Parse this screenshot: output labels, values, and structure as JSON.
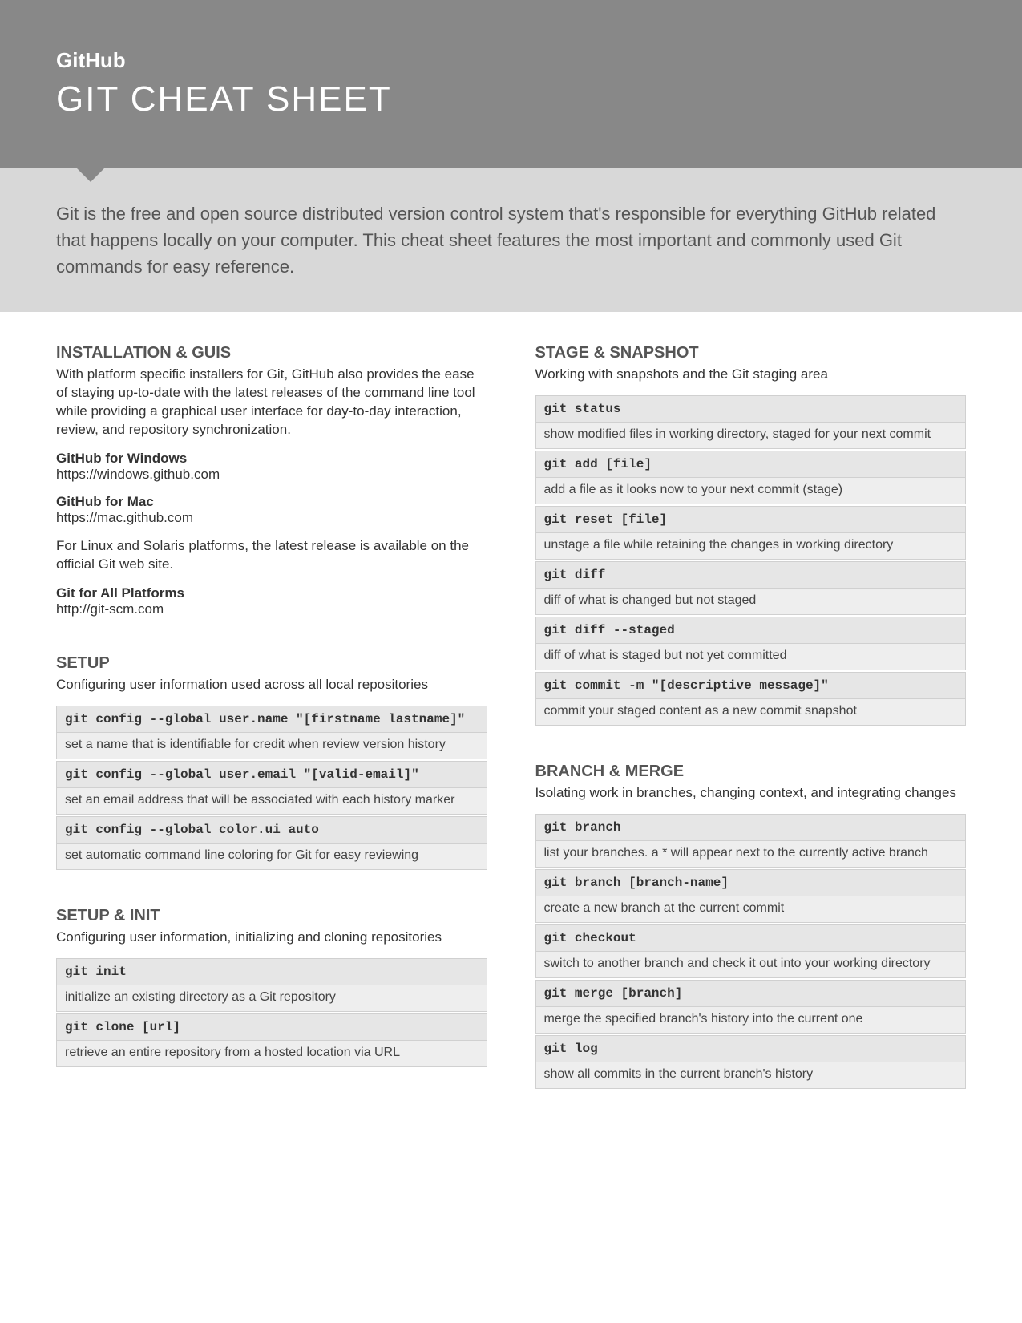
{
  "header": {
    "logo": "GitHub",
    "title": "GIT CHEAT SHEET"
  },
  "intro": "Git is the free and open source distributed version control system that's responsible for everything GitHub related that happens locally on your computer. This cheat sheet features the most important and commonly used Git commands for easy reference.",
  "left": {
    "installation": {
      "title": "INSTALLATION & GUIS",
      "subtitle": "With platform specific installers for Git, GitHub also provides the ease of staying up-to-date with the latest releases of the command line tool while providing a graphical user interface for day-to-day interaction, review, and repository synchronization.",
      "win_label": "GitHub for Windows",
      "win_url": "https://windows.github.com",
      "mac_label": "GitHub for Mac",
      "mac_url": "https://mac.github.com",
      "linux_note": "For Linux and Solaris platforms, the latest release is available on the official Git web site.",
      "all_label": "Git for All Platforms",
      "all_url": "http://git-scm.com"
    },
    "setup": {
      "title": "SETUP",
      "subtitle": "Configuring user information used across all local repositories",
      "items": [
        {
          "cmd": "git config --global user.name \"[firstname lastname]\"",
          "desc": "set a name that is identifiable for credit when review version history"
        },
        {
          "cmd": "git config --global user.email \"[valid-email]\"",
          "desc": "set an email address that will be associated with each history marker"
        },
        {
          "cmd": "git config --global color.ui auto",
          "desc": "set automatic command line coloring for Git for easy reviewing"
        }
      ]
    },
    "setupinit": {
      "title": "SETUP & INIT",
      "subtitle": "Configuring user information, initializing and cloning repositories",
      "items": [
        {
          "cmd": "git init",
          "desc": "initialize an existing directory as a Git repository"
        },
        {
          "cmd": "git clone [url]",
          "desc": "retrieve an entire repository from a hosted location via URL"
        }
      ]
    }
  },
  "right": {
    "stage": {
      "title": "STAGE & SNAPSHOT",
      "subtitle": "Working with snapshots and the Git staging area",
      "items": [
        {
          "cmd": "git status",
          "desc": "show modified files in working directory, staged for your next commit"
        },
        {
          "cmd": "git add [file]",
          "desc": "add a file as it looks now to your next commit (stage)"
        },
        {
          "cmd": "git reset [file]",
          "desc": "unstage a file while retaining the changes in working directory"
        },
        {
          "cmd": "git diff",
          "desc": "diff of what is changed but not staged"
        },
        {
          "cmd": "git diff --staged",
          "desc": "diff of what is staged but not yet committed"
        },
        {
          "cmd": "git commit -m \"[descriptive message]\"",
          "desc": "commit your staged content as a new commit snapshot"
        }
      ]
    },
    "branch": {
      "title": "BRANCH & MERGE",
      "subtitle": "Isolating work in branches, changing context, and integrating changes",
      "items": [
        {
          "cmd": "git branch",
          "desc": "list your branches. a * will appear next to the currently active branch"
        },
        {
          "cmd": "git branch [branch-name]",
          "desc": "create a new branch at the current commit"
        },
        {
          "cmd": "git checkout",
          "desc": "switch to another branch and check it out into your working directory"
        },
        {
          "cmd": "git merge [branch]",
          "desc": "merge the specified branch's history into the current one"
        },
        {
          "cmd": "git log",
          "desc": "show all commits in the current branch's history"
        }
      ]
    }
  }
}
